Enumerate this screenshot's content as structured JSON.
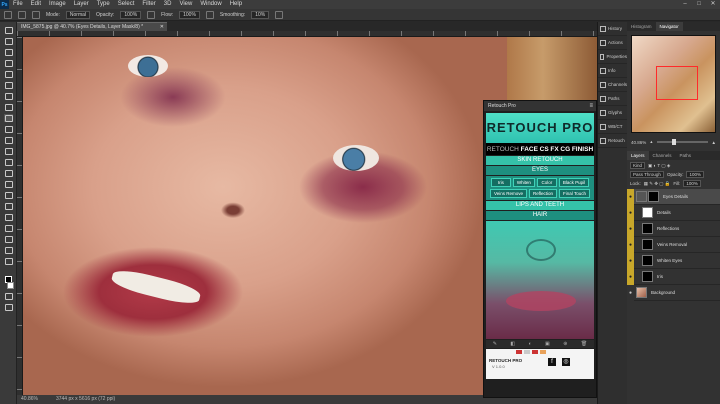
{
  "menubar": {
    "logo": "Ps",
    "items": [
      "File",
      "Edit",
      "Image",
      "Layer",
      "Type",
      "Select",
      "Filter",
      "3D",
      "View",
      "Window",
      "Help"
    ],
    "window_controls": [
      "–",
      "□",
      "✕"
    ]
  },
  "options": {
    "mode_label": "Mode:",
    "mode_value": "Normal",
    "opacity_label": "Opacity:",
    "opacity_value": "100%",
    "flow_label": "Flow:",
    "flow_value": "100%",
    "smoothing_label": "Smoothing:",
    "smoothing_value": "10%"
  },
  "document": {
    "tab_title": "IMG_5875.jpg @ 40.7% (Eyes Details, Layer Mask/8) *",
    "close": "✕"
  },
  "status": {
    "zoom": "40.86%",
    "doc_info": "3744 px x 5616 px (72 ppi)"
  },
  "retouch_panel": {
    "header": "Retouch Pro",
    "logo": "RETOUCH PRO",
    "tabs": [
      "RETOUCH",
      "FACE",
      "CS",
      "FX",
      "CG",
      "FINISH"
    ],
    "skin_bar": "SKIN RETOUCH",
    "eyes_bar": "EYES",
    "eye_buttons": [
      "Iris",
      "Whiten",
      "Color",
      "Black Pupil",
      "Veins Remove",
      "Reflection",
      "Final Touch"
    ],
    "lips_bar": "LIPS AND TEETH",
    "hair_bar": "HAIR",
    "footer_title": "RETOUCH PRO",
    "footer_version": "V 1.0.0",
    "social": [
      "f",
      "◎"
    ]
  },
  "dock_mid": {
    "items": [
      "History",
      "Actions",
      "Properties",
      "Info",
      "Channels",
      "Paths",
      "Glyphs",
      "WB/CT",
      "Retouch"
    ]
  },
  "navigator": {
    "tabs": [
      "Histogram",
      "Navigator"
    ],
    "zoom": "40.86%"
  },
  "layers": {
    "tabs": [
      "Layers",
      "Channels",
      "Paths"
    ],
    "kind_label": "Kind",
    "blend_mode": "Pass Through",
    "opacity_label": "Opacity:",
    "opacity_value": "100%",
    "lock_label": "Lock:",
    "fill_label": "Fill:",
    "fill_value": "100%",
    "items": [
      {
        "name": "Eyes Details",
        "vis": "●"
      },
      {
        "name": "Details",
        "vis": "●"
      },
      {
        "name": "Reflections",
        "vis": "●"
      },
      {
        "name": "Veins Removal",
        "vis": "●"
      },
      {
        "name": "Whiten Eyes",
        "vis": "●"
      },
      {
        "name": "Iris",
        "vis": "●"
      },
      {
        "name": "Background",
        "vis": "●"
      }
    ]
  },
  "colors": {
    "accent_teal": "#35c2a9",
    "layer_vis_yellow": "#c8a72a",
    "navigator_box": "#ff2a2a"
  }
}
